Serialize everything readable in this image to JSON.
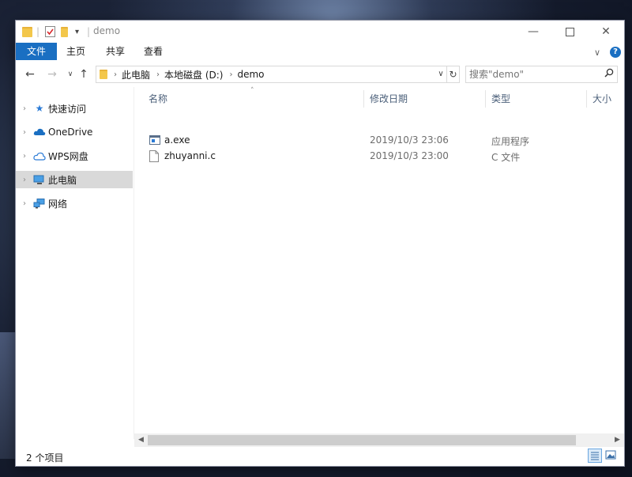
{
  "window": {
    "title": "demo"
  },
  "ribbon": {
    "tabs": [
      "文件",
      "主页",
      "共享",
      "查看"
    ]
  },
  "address": {
    "segments": [
      "此电脑",
      "本地磁盘 (D:)",
      "demo"
    ]
  },
  "search": {
    "placeholder": "搜索\"demo\""
  },
  "sidebar": {
    "items": [
      {
        "label": "快速访问",
        "icon": "star-icon"
      },
      {
        "label": "OneDrive",
        "icon": "cloud-icon"
      },
      {
        "label": "WPS网盘",
        "icon": "cloud-outline-icon"
      },
      {
        "label": "此电脑",
        "icon": "computer-icon"
      },
      {
        "label": "网络",
        "icon": "network-icon"
      }
    ],
    "selected_index": 3
  },
  "columns": [
    "名称",
    "修改日期",
    "类型",
    "大小"
  ],
  "files": [
    {
      "name": "a.exe",
      "modified": "2019/10/3 23:06",
      "type": "应用程序",
      "icon": "exe-icon"
    },
    {
      "name": "zhuyanni.c",
      "modified": "2019/10/3 23:00",
      "type": "C 文件",
      "icon": "file-icon"
    }
  ],
  "status": {
    "item_count": "2 个项目"
  },
  "colors": {
    "accent": "#1a6fc2",
    "selected": "#d9d9d9",
    "header_text": "#4c607a"
  }
}
